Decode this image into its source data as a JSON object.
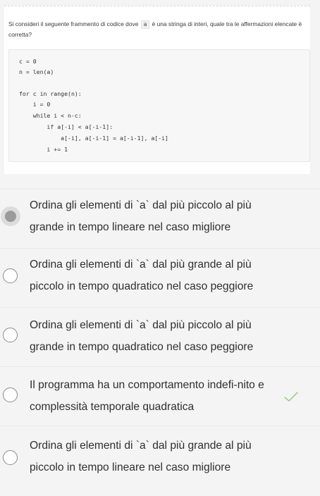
{
  "question": {
    "text_before": "Si consideri il seguente frammento di codice dove",
    "inline_var": "a",
    "text_after": "è una stringa di interi, quale tra le affermazioni elencate è corretta?",
    "code_lines": [
      "c = 0",
      "n = len(a)",
      "",
      "for c in range(n):",
      "    i = 0",
      "    while i < n-c:",
      "        if a[-i] < a[-i-1]:",
      "            a[-i], a[-i-1] = a[-i-1], a[-i]",
      "        i += 1"
    ]
  },
  "options": [
    {
      "label": "Ordina gli elementi di `a` dal più piccolo al più grande in tempo lineare nel caso migliore",
      "selected": true,
      "correct_mark": false
    },
    {
      "label": "Ordina gli elementi di `a` dal più grande al più piccolo in tempo quadratico nel caso peggiore",
      "selected": false,
      "correct_mark": false
    },
    {
      "label": "Ordina gli elementi di `a` dal più piccolo al più grande in tempo quadratico nel caso peggiore",
      "selected": false,
      "correct_mark": false
    },
    {
      "label": "Il programma ha un comportamento indefi-nito e complessità temporale quadratica",
      "selected": false,
      "correct_mark": true
    },
    {
      "label": "Ordina gli elementi di `a` dal più grande al più piccolo in tempo lineare nel caso migliore",
      "selected": false,
      "correct_mark": false
    }
  ],
  "colors": {
    "check": "#9fce8f",
    "radio_selected": "#9a9a9a"
  }
}
